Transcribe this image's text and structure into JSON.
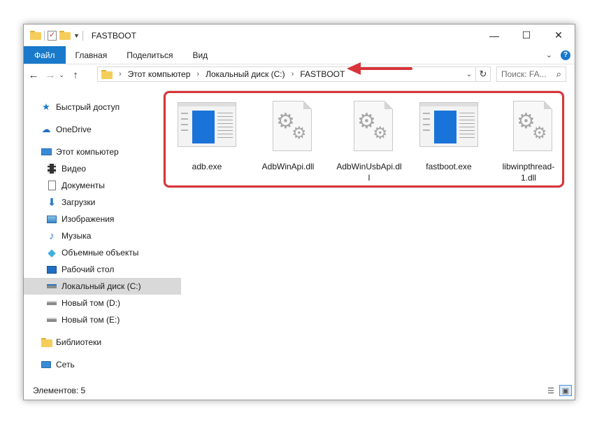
{
  "window": {
    "title": "FASTBOOT",
    "controls": {
      "minimize": "—",
      "maximize": "☐",
      "close": "✕"
    }
  },
  "ribbon": {
    "tabs": [
      {
        "label": "Файл"
      },
      {
        "label": "Главная"
      },
      {
        "label": "Поделиться"
      },
      {
        "label": "Вид"
      }
    ],
    "help": "?"
  },
  "navigation": {
    "back": "←",
    "forward": "→",
    "recent": "⌄",
    "up": "↑",
    "breadcrumbs": [
      "Этот компьютер",
      "Локальный диск (C:)",
      "FASTBOOT"
    ],
    "separator": "›",
    "refresh": "↻",
    "search_placeholder": "Поиск: FA...",
    "search_icon": "⌕"
  },
  "sidebar": {
    "items": [
      {
        "label": "Быстрый доступ",
        "icon": "star-icon",
        "glyph": "★",
        "color": "#1979ca"
      },
      {
        "label": "OneDrive",
        "icon": "cloud-icon",
        "glyph": "☁",
        "color": "#1f6fc5"
      },
      {
        "label": "Этот компьютер",
        "icon": "computer-icon",
        "glyph": "▭",
        "color": "#2f7fc9"
      },
      {
        "label": "Видео",
        "icon": "video-icon",
        "glyph": "▦",
        "color": "#444444"
      },
      {
        "label": "Документы",
        "icon": "documents-icon",
        "glyph": "▤",
        "color": "#666666"
      },
      {
        "label": "Загрузки",
        "icon": "downloads-icon",
        "glyph": "⬇",
        "color": "#2b78c7"
      },
      {
        "label": "Изображения",
        "icon": "pictures-icon",
        "glyph": "▨",
        "color": "#3a88c8"
      },
      {
        "label": "Музыка",
        "icon": "music-icon",
        "glyph": "♪",
        "color": "#2b78c7"
      },
      {
        "label": "Объемные объекты",
        "icon": "3d-objects-icon",
        "glyph": "◆",
        "color": "#3fb0e0"
      },
      {
        "label": "Рабочий стол",
        "icon": "desktop-icon",
        "glyph": "▬",
        "color": "#1f6fc5"
      },
      {
        "label": "Локальный диск (C:)",
        "icon": "drive-c-icon",
        "glyph": "▬",
        "color": "#555555",
        "selected": true
      },
      {
        "label": "Новый том (D:)",
        "icon": "drive-d-icon",
        "glyph": "▬",
        "color": "#555555"
      },
      {
        "label": "Новый том (E:)",
        "icon": "drive-e-icon",
        "glyph": "▬",
        "color": "#555555"
      },
      {
        "label": "Библиотеки",
        "icon": "libraries-icon",
        "glyph": "▥",
        "color": "#d9a53b"
      },
      {
        "label": "Сеть",
        "icon": "network-icon",
        "glyph": "🖧",
        "color": "#2b78c7"
      }
    ]
  },
  "files": [
    {
      "name": "adb.exe",
      "type": "exe"
    },
    {
      "name": "AdbWinApi.dll",
      "type": "dll"
    },
    {
      "name": "AdbWinUsbApi.dll",
      "type": "dll"
    },
    {
      "name": "fastboot.exe",
      "type": "exe"
    },
    {
      "name": "libwinpthread-1.dll",
      "type": "dll"
    }
  ],
  "statusbar": {
    "items_count": "Элементов: 5",
    "view_details": "☰",
    "view_icons": "▣"
  },
  "colors": {
    "accent": "#1979ca",
    "highlight": "#d8343a",
    "selected": "#d9d9d9"
  }
}
